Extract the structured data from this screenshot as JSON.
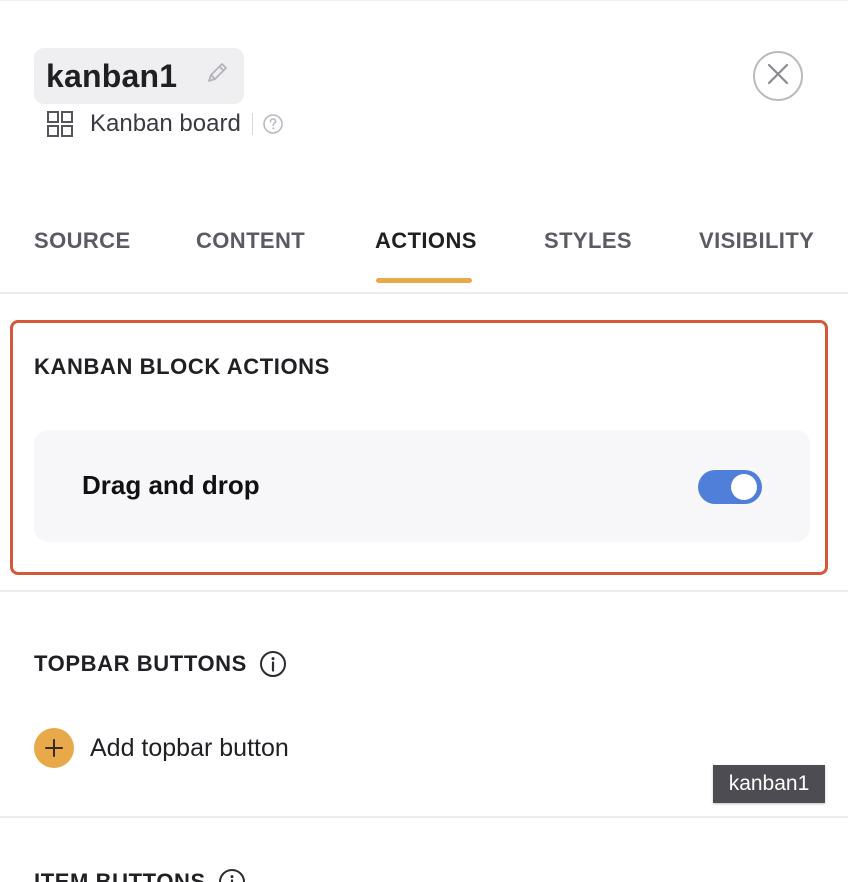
{
  "header": {
    "title": "kanban1",
    "subtitle": "Kanban board",
    "icons": {
      "edit": "pencil-icon",
      "block_type": "grid-icon",
      "help": "question-circle-icon",
      "close": "close-icon"
    }
  },
  "tabs": [
    {
      "label": "SOURCE",
      "active": false
    },
    {
      "label": "CONTENT",
      "active": false
    },
    {
      "label": "ACTIONS",
      "active": true
    },
    {
      "label": "STYLES",
      "active": false
    },
    {
      "label": "VISIBILITY",
      "active": false
    }
  ],
  "kanban_actions": {
    "heading": "KANBAN BLOCK ACTIONS",
    "items": [
      {
        "label": "Drag and drop",
        "enabled": true
      }
    ]
  },
  "topbar_buttons": {
    "heading": "TOPBAR BUTTONS",
    "add_label": "Add topbar button"
  },
  "item_buttons": {
    "heading": "ITEM BUTTONS"
  },
  "tooltip": {
    "text": "kanban1"
  },
  "colors": {
    "accent": "#e8a94a",
    "toggle_on": "#4f7fd8",
    "highlight_border": "#d6583a",
    "tooltip_bg": "#4c4c52"
  }
}
